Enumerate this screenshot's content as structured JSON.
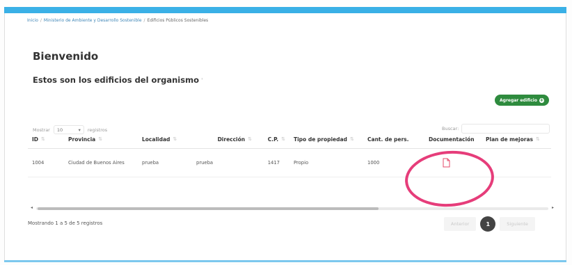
{
  "breadcrumb": {
    "items": [
      "Inicio",
      "Ministerio de Ambiente y Desarrollo Sostenible",
      "Edificios Públicos Sostenibles"
    ]
  },
  "page": {
    "title": "Bienvenido",
    "subtitle": "Estos son los edificios del organismo"
  },
  "toolbar": {
    "add_label": "Agregar edificio",
    "show_label": "Mostrar",
    "show_value": "10",
    "records_label": "registros",
    "search_label": "Buscar:",
    "search_placeholder": ""
  },
  "table": {
    "headers": {
      "id": "ID",
      "provincia": "Provincia",
      "localidad": "Localidad",
      "direccion": "Dirección",
      "cp": "C.P.",
      "tipo": "Tipo de propiedad",
      "cant": "Cant. de pers.",
      "doc": "Documentación",
      "plan": "Plan de mejoras"
    },
    "rows": [
      {
        "id": "1004",
        "provincia": "Ciudad de Buenos Aires",
        "localidad": "prueba",
        "direccion": "prueba",
        "cp": "1417",
        "tipo": "Propio",
        "cant": "1000",
        "doc_icon": "document-icon",
        "plan": ""
      }
    ]
  },
  "footer": {
    "info": "Mostrando 1 a 5 de 5 registros",
    "prev_label": "Anterior",
    "page_number": "1",
    "next_label": "Siguiente"
  },
  "colors": {
    "accent_blue": "#3ab0e6",
    "add_button": "#2e8b3e",
    "highlight": "#e63d7a",
    "doc_icon": "#e5486a"
  }
}
